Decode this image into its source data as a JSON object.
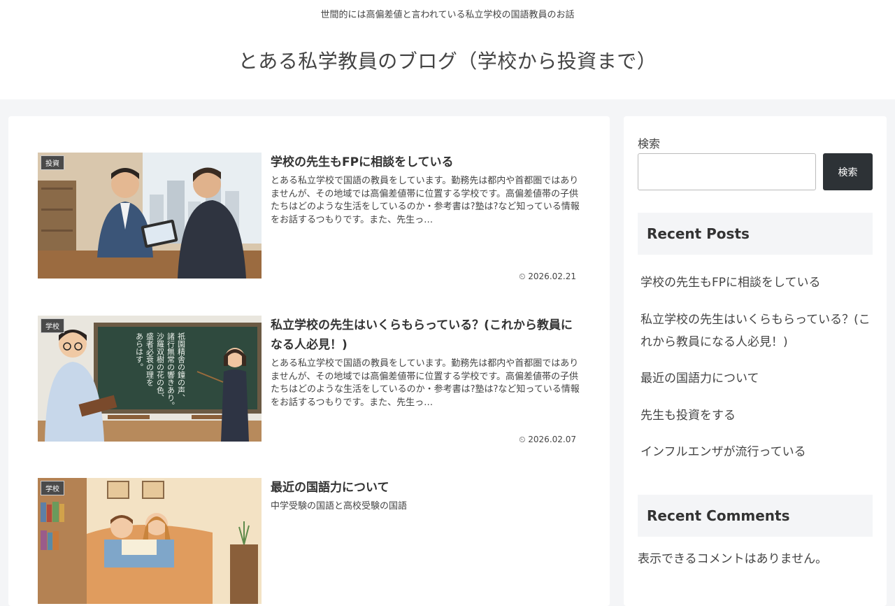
{
  "header": {
    "tagline": "世間的には高偏差値と言われている私立学校の国語教員のお話",
    "title": "とある私学教員のブログ（学校から投資まで）"
  },
  "posts": [
    {
      "category": "投資",
      "title": "学校の先生もFPに相談をしている",
      "excerpt": "とある私立学校で国語の教員をしています。勤務先は都内や首都圏ではありませんが、その地域では高偏差値帯に位置する学校です。高偏差値帯の子供たちはどのような生活をしているのか・参考書は?塾は?など知っている情報をお話するつもりです。また、先生っ…",
      "date": "2026.02.21"
    },
    {
      "category": "学校",
      "title": "私立学校の先生はいくらもらっている？(これから教員になる人必見！)",
      "excerpt": "とある私立学校で国語の教員をしています。勤務先は都内や首都圏ではありませんが、その地域では高偏差値帯に位置する学校です。高偏差値帯の子供たちはどのような生活をしているのか・参考書は?塾は?など知っている情報をお話するつもりです。また、先生っ…",
      "date": "2026.02.07"
    },
    {
      "category": "学校",
      "title": "最近の国語力について",
      "excerpt": "中学受験の国語と高校受験の国語",
      "date": ""
    }
  ],
  "blackboard_text": [
    "祇園精舎の鐘の声、",
    "諸行無常の響きあり。",
    "沙羅双樹の花の色、",
    "盛者必衰の理を",
    "あらはす。"
  ],
  "sidebar": {
    "search_label": "検索",
    "search_button": "検索",
    "recent_posts_title": "Recent Posts",
    "recent_posts": [
      "学校の先生もFPに相談をしている",
      "私立学校の先生はいくらもらっている？(これから教員になる人必見！)",
      "最近の国語力について",
      "先生も投資をする",
      "インフルエンザが流行っている"
    ],
    "recent_comments_title": "Recent Comments",
    "no_comments": "表示できるコメントはありません。"
  },
  "date_icon": "clock-icon"
}
